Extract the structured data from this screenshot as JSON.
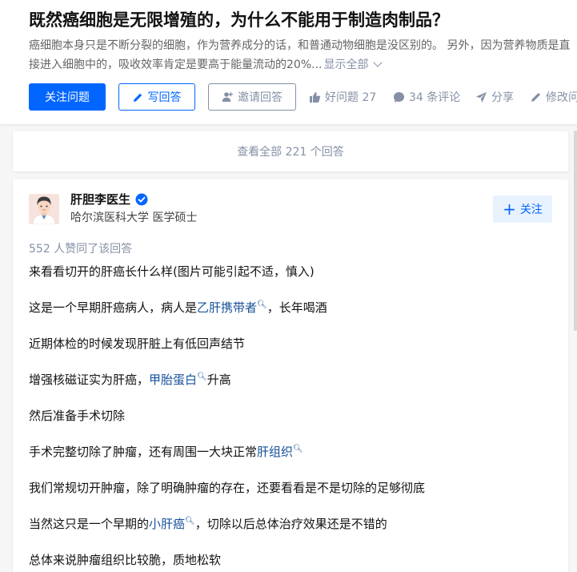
{
  "question": {
    "title": "既然癌细胞是无限增殖的，为什么不能用于制造肉制品？",
    "desc_text": "癌细胞本身只是不断分裂的细胞，作为营养成分的话，和普通动物细胞是没区别的。 另外，因为营养物质是直接进入细胞中的，吸收效率肯定是要高于能量流动的20%...",
    "show_all": "显示全部"
  },
  "actions": {
    "follow": "关注问题",
    "write": "写回答",
    "invite": "邀请回答",
    "good": "好问题 27",
    "comments": "34 条评论",
    "share": "分享",
    "edit": "修改问"
  },
  "view_all": "查看全部 221 个回答",
  "answer": {
    "author": "肝胆李医生",
    "bio": "哈尔滨医科大学 医学硕士",
    "follow": "关注",
    "votes": "552 人赞同了该回答",
    "p1": "来看看切开的肝癌长什么样(图片可能引起不适，慎入)",
    "p2a": "这是一个早期肝癌病人，病人是",
    "p2link": "乙肝携带者",
    "p2b": "，长年喝酒",
    "p3": "近期体检的时候发现肝脏上有低回声结节",
    "p4a": "增强核磁证实为肝癌，",
    "p4link": "甲胎蛋白",
    "p4b": "升高",
    "p5": "然后准备手术切除",
    "p6a": "手术完整切除了肿瘤，还有周围一大块正常",
    "p6link": "肝组织",
    "p7": "我们常规切开肿瘤，除了明确肿瘤的存在，还要看看是不是切除的足够彻底",
    "p8a": "当然这只是一个早期的",
    "p8link": "小肝癌",
    "p8b": "，切除以后总体治疗效果还是不错的",
    "p9": "总体来说肿瘤组织比较脆，质地松软"
  },
  "colors": {
    "accent": "#0066ff",
    "link": "#175199",
    "muted": "#8590a6"
  }
}
